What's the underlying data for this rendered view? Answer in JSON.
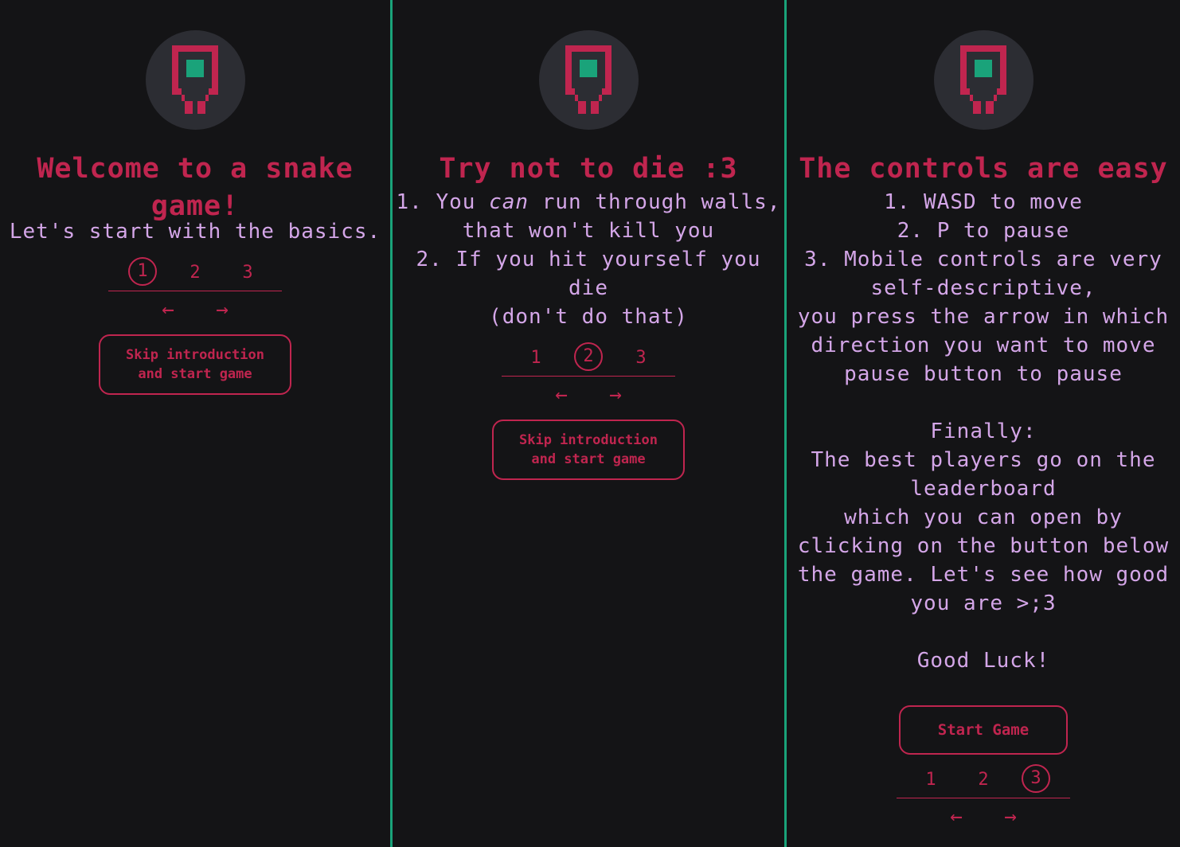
{
  "colors": {
    "accent": "#c0254f",
    "text": "#d4a6e8",
    "green": "#1aa37a",
    "background": "#141416",
    "logo_bg": "#2c2d33"
  },
  "logo": {
    "icon": "snake-logo-icon"
  },
  "panel1": {
    "title": "Welcome to a snake game!",
    "subtitle": "Let's start with the basics.",
    "steps": [
      "1",
      "2",
      "3"
    ],
    "active_step": "1",
    "prev_arrow": "←",
    "next_arrow": "→",
    "skip_label": "Skip introduction\nand start game"
  },
  "panel2": {
    "title": "Try not to die :3",
    "line1_prefix": "1. You ",
    "line1_em": "can",
    "line1_suffix": " run through walls, that won't kill you",
    "line2": "2. If you hit yourself you die",
    "line3": "(don't do that)",
    "steps": [
      "1",
      "2",
      "3"
    ],
    "active_step": "2",
    "prev_arrow": "←",
    "next_arrow": "→",
    "skip_label": "Skip introduction\nand start game"
  },
  "panel3": {
    "title": "The controls are easy",
    "line1": "1. WASD to move",
    "line2": "2. P to pause",
    "line3": "3. Mobile controls are very self-descriptive,",
    "line4": "you press the arrow in which direction you want to move",
    "line5": "pause button to pause",
    "finally": "Finally:",
    "lb1": "The best players go on the leaderboard",
    "lb2": "which you can open by clicking on the button below the game. Let's see how good you are >;3",
    "good_luck": "Good Luck!",
    "start_label": "Start Game",
    "steps": [
      "1",
      "2",
      "3"
    ],
    "active_step": "3",
    "prev_arrow": "←",
    "next_arrow": "→"
  }
}
